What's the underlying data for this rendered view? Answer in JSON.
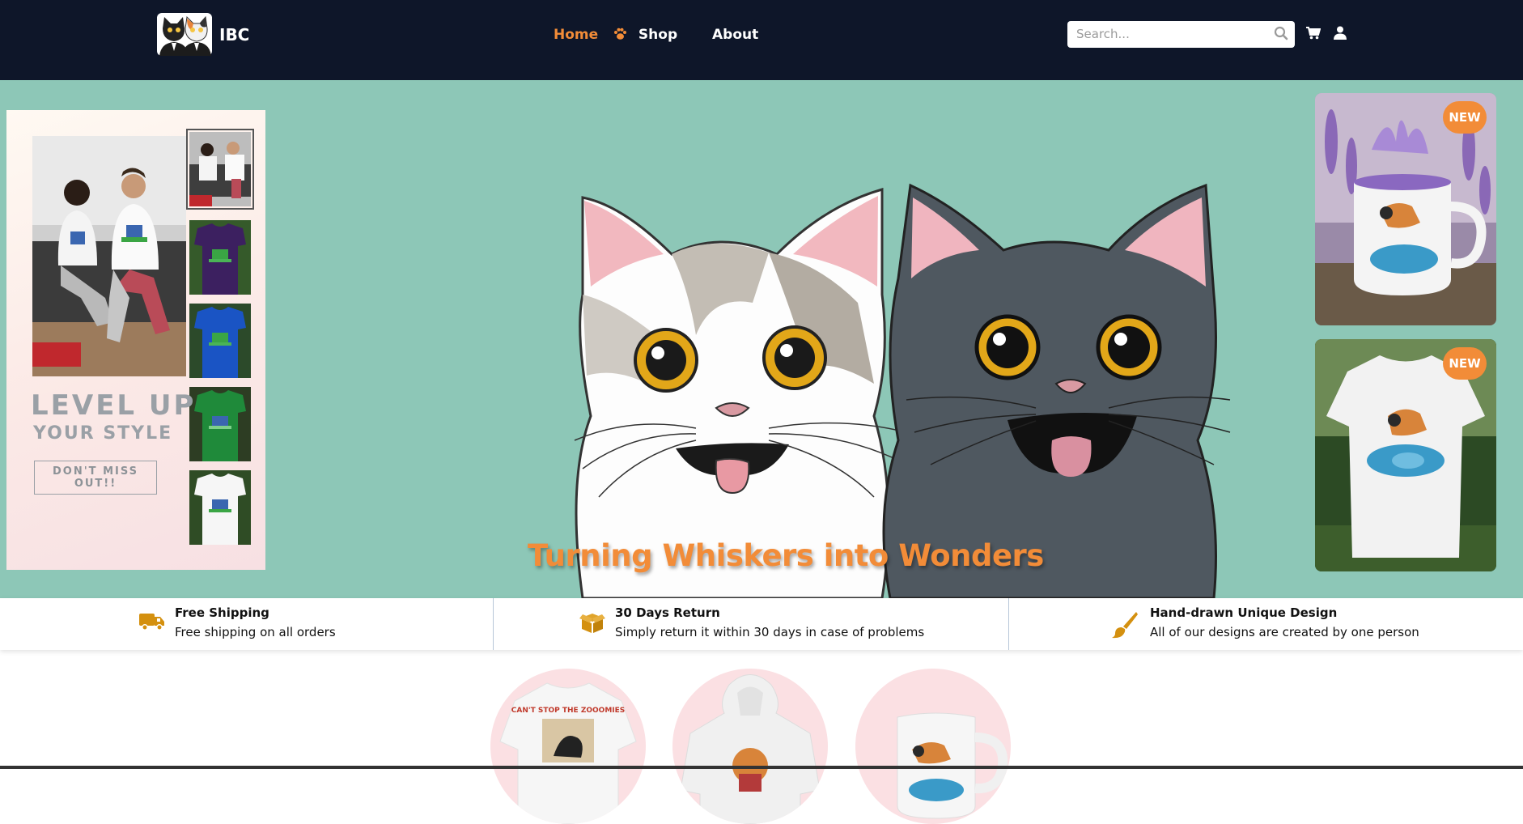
{
  "header": {
    "brand": "IBC",
    "nav": {
      "home": "Home",
      "shop": "Shop",
      "about": "About"
    },
    "search": {
      "placeholder": "Search..."
    }
  },
  "hero": {
    "promo": {
      "headline": "LEVEL UP",
      "subheadline": "YOUR STYLE",
      "button": "DON'T MISS OUT!!",
      "thumbnail_colors": [
        "white",
        "purple",
        "blue",
        "green",
        "white"
      ]
    },
    "tagline": "Turning Whiskers into Wonders",
    "new_items": [
      {
        "badge": "NEW",
        "product": "mug"
      },
      {
        "badge": "NEW",
        "product": "t-shirt"
      }
    ]
  },
  "features": [
    {
      "icon": "truck-icon",
      "title": "Free Shipping",
      "subtitle": "Free shipping on all orders"
    },
    {
      "icon": "box-icon",
      "title": "30 Days Return",
      "subtitle": "Simply return it within 30 days in case of problems"
    },
    {
      "icon": "brush-icon",
      "title": "Hand-drawn Unique Design",
      "subtitle": "All of our designs are created by one person"
    }
  ],
  "categories": [
    {
      "product": "t-shirt",
      "print_text": "CAN'T STOP THE ZOOOMIES"
    },
    {
      "product": "hoodie",
      "print_text": ""
    },
    {
      "product": "mug",
      "print_text": ""
    }
  ],
  "colors": {
    "navy": "#0e1629",
    "accent": "#f28c38",
    "hero_bg": "#8dc7b7",
    "icon_gold": "#d4900f",
    "circle_pink": "#fbe0e3"
  }
}
